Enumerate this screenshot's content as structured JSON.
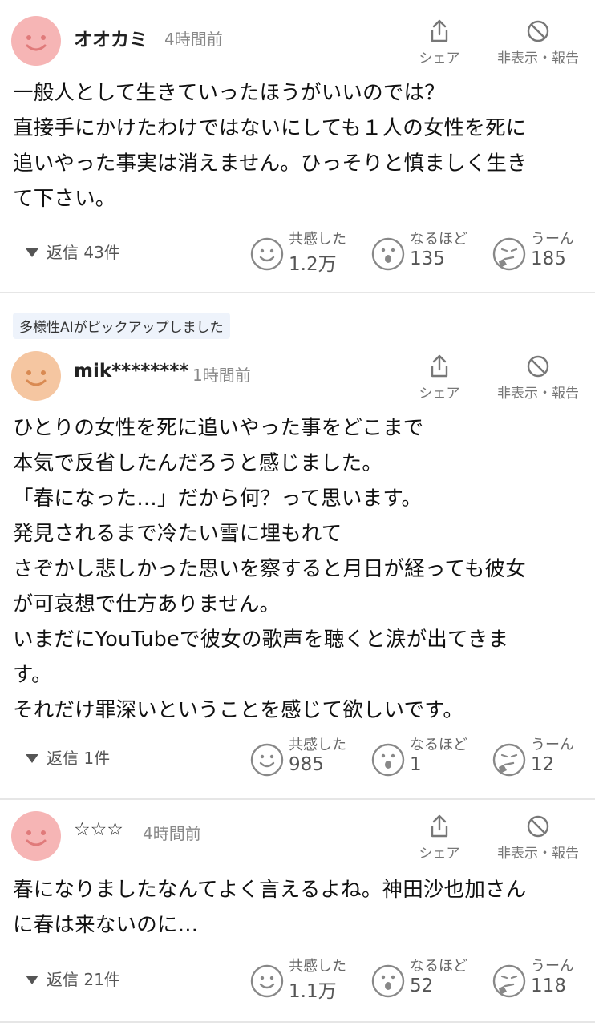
{
  "comments": [
    {
      "username": "オオカミ",
      "time": "4時間前",
      "avatar_color": "#f6b5b5",
      "share_label": "シェア",
      "hide_label": "非表示・報告",
      "lines": [
        "一般人として生きていったほうがいいのでは？",
        "直接手にかけたわけではないにしても１人の女性を死に",
        "追いやった事実は消えません。ひっそりと慎ましく生き",
        "て下さい。"
      ],
      "replies": "返信 43件",
      "reactions": [
        {
          "label": "共感した",
          "count": "1.2万",
          "icon": "smile-icon"
        },
        {
          "label": "なるほど",
          "count": "135",
          "icon": "surprised-icon"
        },
        {
          "label": "うーん",
          "count": "185",
          "icon": "thinking-icon"
        }
      ]
    },
    {
      "badge": "多様性AIがピックアップしました",
      "username": "mik********",
      "time": "1時間前",
      "avatar_color": "#f5c6a1",
      "share_label": "シェア",
      "hide_label": "非表示・報告",
      "lines": [
        "ひとりの女性を死に追いやった事をどこまで",
        "本気で反省したんだろうと感じました。",
        "「春になった…」だから何？って思います。",
        "発見されるまで冷たい雪に埋もれて",
        "さぞかし悲しかった思いを察すると月日が経っても彼女",
        "が可哀想で仕方ありません。",
        "いまだにYouTubeで彼女の歌声を聴くと涙が出てきま",
        "す。",
        "それだけ罪深いということを感じて欲しいです。"
      ],
      "replies": "返信 1件",
      "reactions": [
        {
          "label": "共感した",
          "count": "985",
          "icon": "smile-icon"
        },
        {
          "label": "なるほど",
          "count": "1",
          "icon": "surprised-icon"
        },
        {
          "label": "うーん",
          "count": "12",
          "icon": "thinking-icon"
        }
      ]
    },
    {
      "username": "☆☆☆",
      "time": "4時間前",
      "avatar_color": "#f6b5b5",
      "share_label": "シェア",
      "hide_label": "非表示・報告",
      "lines": [
        "春になりましたなんてよく言えるよね。神田沙也加さん",
        "に春は来ないのに…"
      ],
      "replies": "返信 21件",
      "reactions": [
        {
          "label": "共感した",
          "count": "1.1万",
          "icon": "smile-icon"
        },
        {
          "label": "なるほど",
          "count": "52",
          "icon": "surprised-icon"
        },
        {
          "label": "うーん",
          "count": "118",
          "icon": "thinking-icon"
        }
      ]
    }
  ]
}
